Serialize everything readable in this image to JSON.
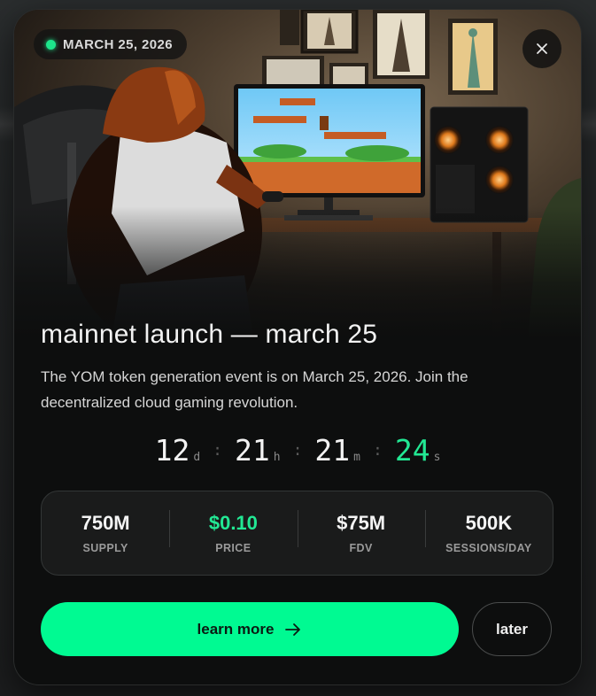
{
  "date_badge": {
    "label": "MARCH 25, 2026",
    "dot_color": "#1de58b"
  },
  "close_button": {
    "icon": "close-icon"
  },
  "hero": {
    "image_alt": "orangutan gamer at computer"
  },
  "title": "mainnet launch — march 25",
  "description": "The YOM token generation event is on March 25, 2026. Join the decentralized cloud gaming revolution.",
  "countdown": {
    "days": "12",
    "days_unit": "d",
    "hours": "21",
    "hours_unit": "h",
    "minutes": "21",
    "minutes_unit": "m",
    "seconds": "24",
    "seconds_unit": "s",
    "separator": ":"
  },
  "stats": [
    {
      "value": "750M",
      "label": "SUPPLY"
    },
    {
      "value": "$0.10",
      "label": "PRICE"
    },
    {
      "value": "$75M",
      "label": "FDV"
    },
    {
      "value": "500K",
      "label": "SESSIONS/DAY"
    }
  ],
  "actions": {
    "learn_more_label": "learn more",
    "later_label": "later"
  },
  "colors": {
    "accent": "#00fa92",
    "background": "#0d0e0e"
  }
}
